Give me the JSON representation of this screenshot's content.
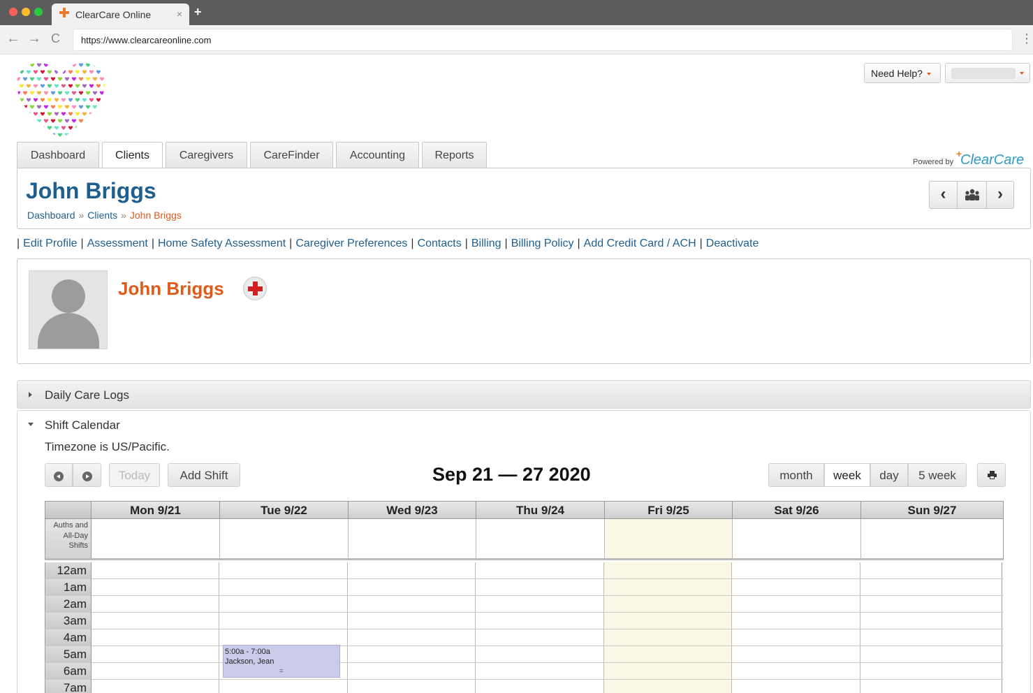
{
  "browser": {
    "tab_title": "ClearCare Online",
    "tab_close": "×",
    "new_tab": "+",
    "url": "https://www.clearcareonline.com",
    "back": "←",
    "forward": "→",
    "reload": "C",
    "menu": "⋮"
  },
  "header": {
    "need_help": "Need Help?",
    "powered_by": "Powered by",
    "brand": "ClearCare",
    "brand_mark": "+"
  },
  "nav": {
    "tabs": [
      "Dashboard",
      "Clients",
      "Caregivers",
      "CareFinder",
      "Accounting",
      "Reports"
    ],
    "active": "Clients"
  },
  "page": {
    "title": "John Briggs",
    "breadcrumb": [
      "Dashboard",
      "Clients",
      "John Briggs"
    ],
    "breadcrumb_sep": "»",
    "pager": {
      "prev": "‹",
      "next": "›"
    }
  },
  "sublinks": [
    "Edit Profile",
    "Assessment",
    "Home Safety Assessment",
    "Caregiver Preferences",
    "Contacts",
    "Billing",
    "Billing Policy",
    "Add Credit Card / ACH",
    "Deactivate"
  ],
  "profile": {
    "name": "John Briggs"
  },
  "sections": {
    "daily_care_logs": "Daily Care Logs",
    "shift_calendar": "Shift Calendar",
    "timezone": "Timezone is US/Pacific."
  },
  "calendar": {
    "today_label": "Today",
    "add_shift_label": "Add Shift",
    "title": "Sep 21 — 27 2020",
    "views": [
      "month",
      "week",
      "day",
      "5 week"
    ],
    "active_view": "week",
    "allday_label": "Auths and All-Day Shifts",
    "days": [
      "Mon 9/21",
      "Tue 9/22",
      "Wed 9/23",
      "Thu 9/24",
      "Fri 9/25",
      "Sat 9/26",
      "Sun 9/27"
    ],
    "today_day": "Fri 9/25",
    "hours": [
      "12am",
      "1am",
      "2am",
      "3am",
      "4am",
      "5am",
      "6am",
      "7am"
    ],
    "event": {
      "time": "5:00a - 7:00a",
      "name": "Jackson, Jean",
      "handle": "="
    }
  },
  "colors": {
    "link": "#1e5f8f",
    "accent": "#e05a1a",
    "event": "#c9cbe9",
    "today": "#fcf8e8"
  }
}
